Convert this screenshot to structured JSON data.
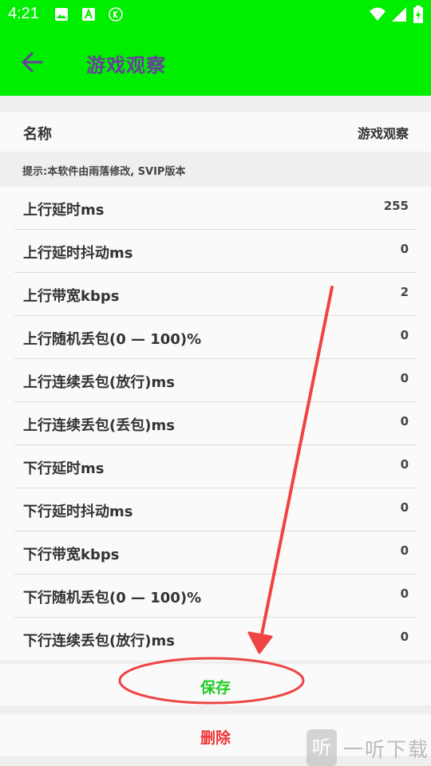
{
  "status_bar": {
    "time": "4:21"
  },
  "app_bar": {
    "title": "游戏观察",
    "back_icon": "arrow-left-icon"
  },
  "colors": {
    "accent": "#00ee00",
    "title": "#6a3f9c",
    "save": "#22cc22",
    "delete": "#ee3333",
    "annotation": "#ee4444"
  },
  "name_row": {
    "label": "名称",
    "value": "游戏观察"
  },
  "hint": "提示:本软件由雨落修改, SVIP版本",
  "settings": [
    {
      "label": "上行延时ms",
      "value": "255"
    },
    {
      "label": "上行延时抖动ms",
      "value": "0"
    },
    {
      "label": "上行带宽kbps",
      "value": "2"
    },
    {
      "label": "上行随机丢包(0 — 100)%",
      "value": "0"
    },
    {
      "label": "上行连续丢包(放行)ms",
      "value": "0"
    },
    {
      "label": "上行连续丢包(丢包)ms",
      "value": "0"
    },
    {
      "label": "下行延时ms",
      "value": "0"
    },
    {
      "label": "下行延时抖动ms",
      "value": "0"
    },
    {
      "label": "下行带宽kbps",
      "value": "0"
    },
    {
      "label": "下行随机丢包(0 — 100)%",
      "value": "0"
    },
    {
      "label": "下行连续丢包(放行)ms",
      "value": "0"
    }
  ],
  "actions": {
    "save": "保存",
    "delete": "删除"
  },
  "watermark": {
    "mark": "听",
    "text": "一听下载"
  }
}
